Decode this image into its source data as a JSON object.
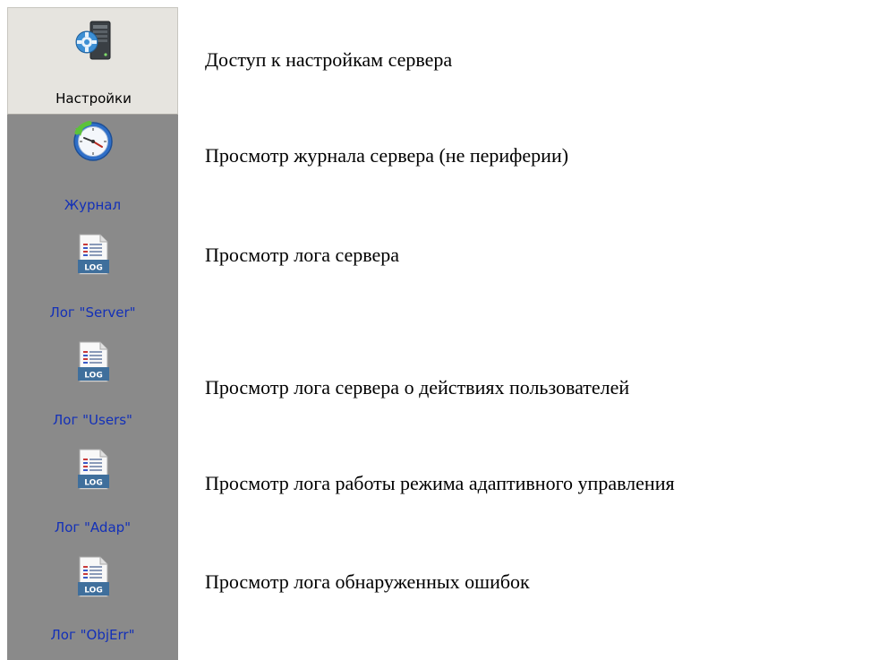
{
  "sidebar": {
    "items": [
      {
        "label": "Настройки",
        "icon": "server-settings-icon",
        "selected": true
      },
      {
        "label": "Журнал",
        "icon": "clock-icon",
        "selected": false
      },
      {
        "label": "Лог \"Server\"",
        "icon": "log-file-icon",
        "selected": false
      },
      {
        "label": "Лог \"Users\"",
        "icon": "log-file-icon",
        "selected": false
      },
      {
        "label": "Лог \"Adap\"",
        "icon": "log-file-icon",
        "selected": false
      },
      {
        "label": "Лог \"ObjErr\"",
        "icon": "log-file-icon",
        "selected": false
      }
    ],
    "icon_text": "LOG"
  },
  "descriptions": [
    "Доступ к настройкам сервера",
    "Просмотр журнала сервера (не периферии)",
    "Просмотр лога сервера",
    "Просмотр лога сервера о действиях пользователей",
    "Просмотр лога работы режима адаптивного управления",
    "Просмотр лога обнаруженных ошибок"
  ],
  "colors": {
    "sidebar_bg": "#8a8a8a",
    "selected_bg": "#e6e4df",
    "label_link": "#1330b8",
    "label_selected": "#000000"
  }
}
